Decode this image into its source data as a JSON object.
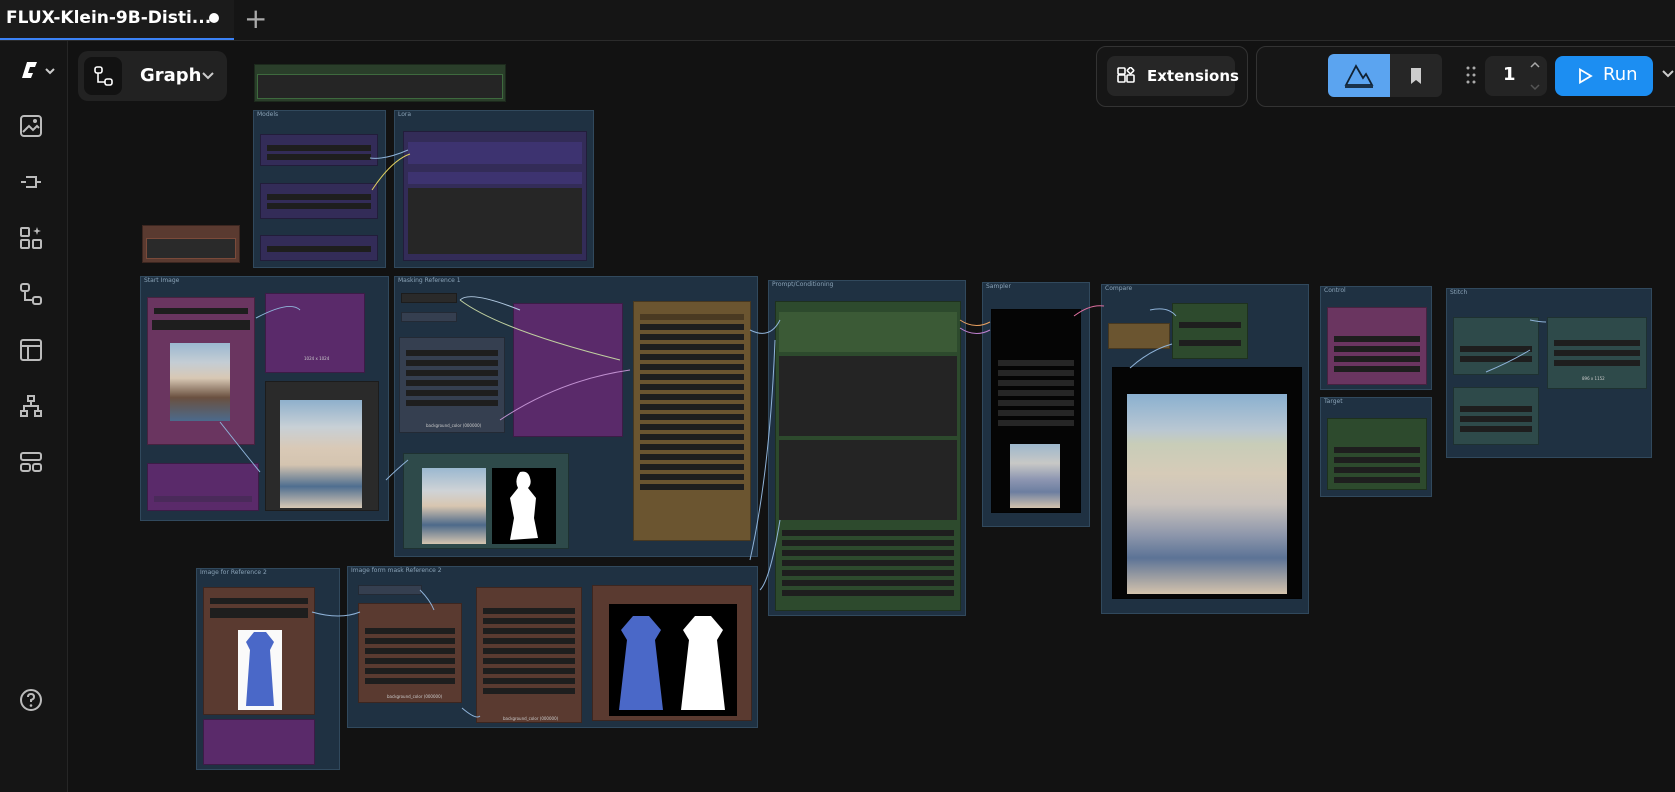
{
  "tab": {
    "title": "FLUX-Klein-9B-Disti...",
    "plus": "+"
  },
  "toolbar": {
    "graph_label": "Graph",
    "extensions_label": "Extensions",
    "queue_count": "1",
    "run_label": "Run"
  },
  "groups": {
    "models": "Models",
    "lora": "Lora",
    "start_image": "Start Image",
    "masking_ref1": "Masking Reference 1",
    "prompt_cond": "Prompt/Conditioning",
    "sampler": "Sampler",
    "compare": "Compare",
    "control": "Control",
    "target": "Target",
    "stitch": "Stitch",
    "image_ref2": "Image for Reference 2",
    "mask_ref2": "Image form mask Reference 2"
  },
  "node_labels": {
    "size1": "1024 x 1024",
    "bg1": "background_color (000000)",
    "size2": "896 x 1152",
    "bg2": "background_color (000000)",
    "bg3": "background_color (000000)",
    "size3": "1024 x 1024",
    "mini1": "1024 x 1024"
  },
  "colors": {
    "accent": "#1c8ef2",
    "mode_active": "#5ba4f0",
    "group_bg": "#1f3142"
  }
}
